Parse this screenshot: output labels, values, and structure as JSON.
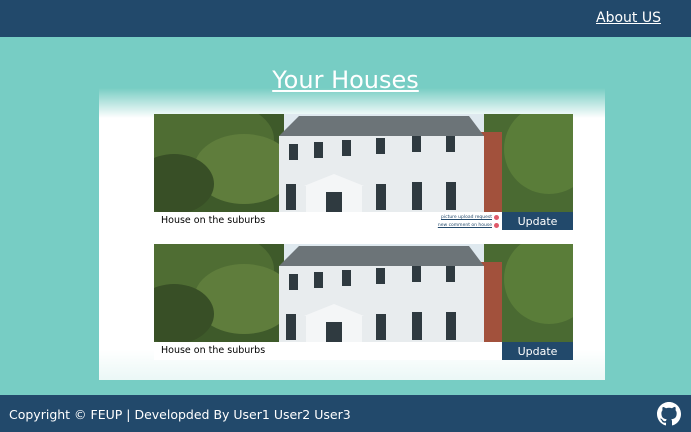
{
  "header": {
    "about_label": "About US"
  },
  "main": {
    "title": "Your Houses",
    "houses": [
      {
        "name": "House on the suburbs",
        "update_label": "Update",
        "notifications": [
          "picture upload request",
          "new comment on house"
        ]
      },
      {
        "name": "House on the suburbs",
        "update_label": "Update",
        "notifications": []
      }
    ]
  },
  "footer": {
    "text": "Copyright © FEUP | Developded By User1 User2 User3",
    "icon": "github-icon"
  },
  "colors": {
    "background": "#77cdc4",
    "navbar": "#22496b",
    "notification_dot": "#e05a6a"
  }
}
